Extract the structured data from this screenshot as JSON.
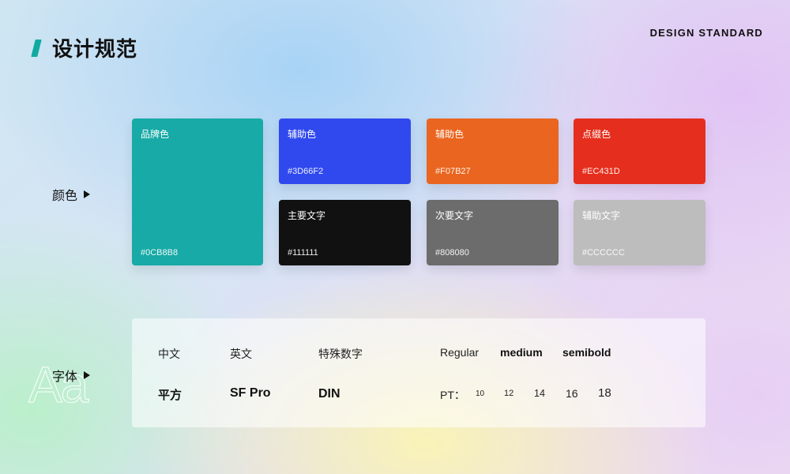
{
  "header": {
    "title": "设计规范",
    "subtitle": "DESIGN STANDARD"
  },
  "sections": {
    "color_label": "颜色",
    "font_label": "字体",
    "aa_mark": "Aa"
  },
  "colors": [
    {
      "name": "品牌色",
      "hex": "#0CB8B8",
      "fill": "#17AAA6"
    },
    {
      "name": "辅助色",
      "hex": "#3D66F2",
      "fill": "#3049EE"
    },
    {
      "name": "辅助色",
      "hex": "#F07B27",
      "fill": "#EA651F"
    },
    {
      "name": "点缀色",
      "hex": "#EC431D",
      "fill": "#E52E1D"
    },
    {
      "name": "主要文字",
      "hex": "#111111",
      "fill": "#111111"
    },
    {
      "name": "次要文字",
      "hex": "#808080",
      "fill": "#6C6C6C"
    },
    {
      "name": "辅助文字",
      "hex": "#CCCCCC",
      "fill": "#BDBDBD"
    }
  ],
  "fonts": {
    "chinese_label": "中文",
    "chinese_value": "平方",
    "english_label": "英文",
    "english_value": "SF Pro",
    "number_label": "特殊数字",
    "number_value": "DIN",
    "weights": [
      "Regular",
      "medium",
      "semibold"
    ],
    "pt_label": "PT：",
    "sizes": [
      "10",
      "12",
      "14",
      "16",
      "18"
    ]
  }
}
